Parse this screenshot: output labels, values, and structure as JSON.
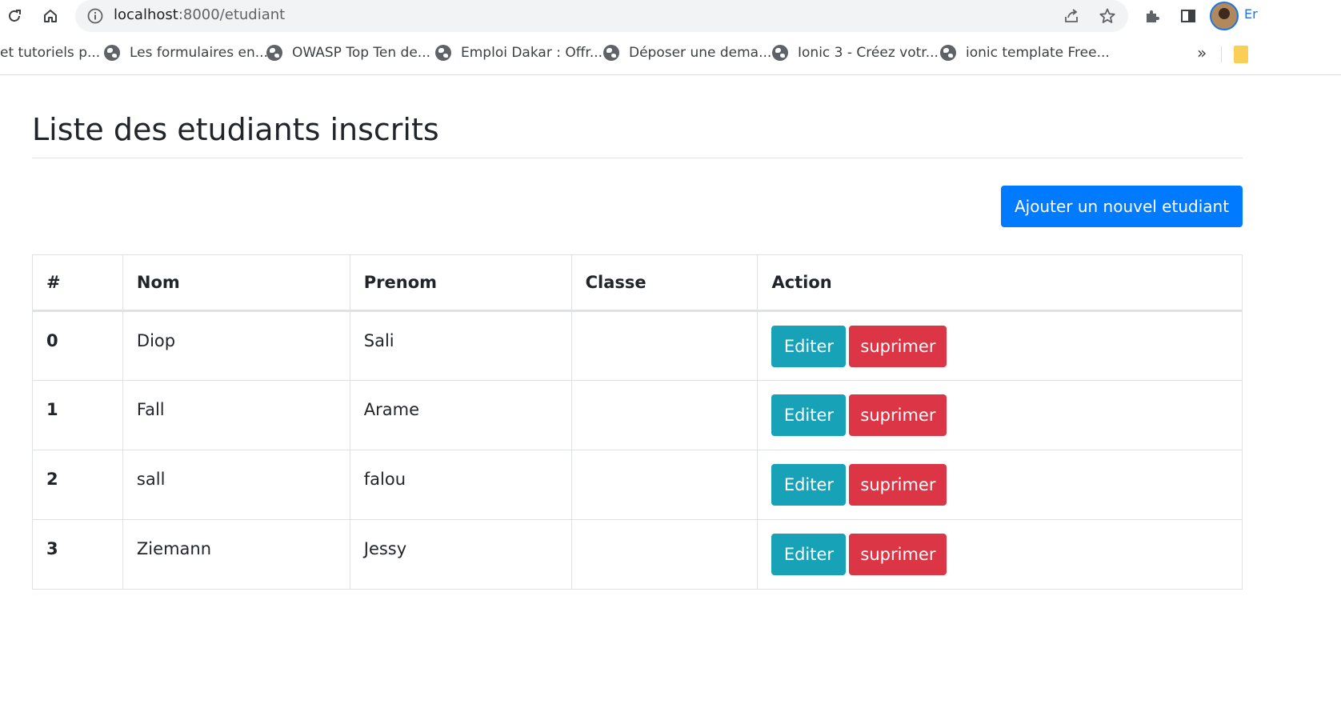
{
  "browser": {
    "url_host": "localhost",
    "url_path": ":8000/etudiant",
    "profile_label": "Er",
    "bookmarks": [
      "et tutoriels p...",
      "Les formulaires en...",
      "OWASP Top Ten de...",
      "Emploi Dakar : Offr...",
      "Déposer une dema...",
      "Ionic 3 - Créez votr...",
      "ionic template Free..."
    ],
    "more_label": "»"
  },
  "page": {
    "title": "Liste des etudiants inscrits",
    "add_button": "Ajouter un nouvel etudiant"
  },
  "table": {
    "headers": [
      "#",
      "Nom",
      "Prenom",
      "Classe",
      "Action"
    ],
    "rows": [
      {
        "index": "0",
        "nom": "Diop",
        "prenom": "Sali",
        "classe": ""
      },
      {
        "index": "1",
        "nom": "Fall",
        "prenom": "Arame",
        "classe": ""
      },
      {
        "index": "2",
        "nom": "sall",
        "prenom": "falou",
        "classe": ""
      },
      {
        "index": "3",
        "nom": "Ziemann",
        "prenom": "Jessy",
        "classe": ""
      }
    ],
    "edit_label": "Editer",
    "delete_label": "suprimer"
  },
  "colors": {
    "primary": "#007bff",
    "info": "#17a2b8",
    "danger": "#dc3545"
  }
}
